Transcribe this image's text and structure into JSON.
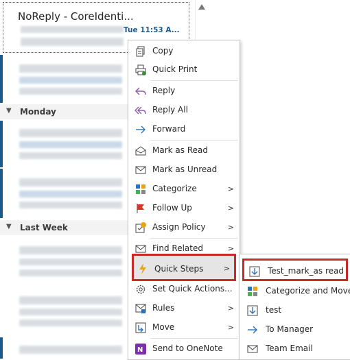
{
  "message_list": {
    "first_message": {
      "sender": "NoReply - CoreIdenti...",
      "time": "Tue 11:53 A..."
    },
    "groups": [
      {
        "label": "Monday"
      },
      {
        "label": "Last Week"
      }
    ]
  },
  "context_menu": {
    "items": [
      {
        "label": "Copy",
        "icon": "copy-icon"
      },
      {
        "label": "Quick Print",
        "icon": "print-icon"
      },
      {
        "label": "Reply",
        "icon": "reply-icon"
      },
      {
        "label": "Reply All",
        "icon": "reply-all-icon"
      },
      {
        "label": "Forward",
        "icon": "forward-icon"
      },
      {
        "label": "Mark as Read",
        "icon": "mark-read-icon"
      },
      {
        "label": "Mark as Unread",
        "icon": "mark-unread-icon"
      },
      {
        "label": "Categorize",
        "icon": "categorize-icon"
      },
      {
        "label": "Follow Up",
        "icon": "flag-icon"
      },
      {
        "label": "Assign Policy",
        "icon": "policy-icon"
      },
      {
        "label": "Find Related",
        "icon": "find-related-icon"
      },
      {
        "label": "Quick Steps",
        "icon": "quick-steps-icon"
      },
      {
        "label": "Set Quick Actions...",
        "icon": "gear-icon"
      },
      {
        "label": "Rules",
        "icon": "rules-icon"
      },
      {
        "label": "Move",
        "icon": "move-icon"
      },
      {
        "label": "Send to OneNote",
        "icon": "onenote-icon"
      }
    ]
  },
  "quick_steps_submenu": {
    "items": [
      {
        "label": "Test_mark_as read",
        "icon": "quick-step-icon"
      },
      {
        "label": "Categorize and Move",
        "icon": "categorize-icon"
      },
      {
        "label": "test",
        "icon": "quick-step-icon"
      },
      {
        "label": "To Manager",
        "icon": "forward-icon"
      },
      {
        "label": "Team Email",
        "icon": "mail-icon"
      }
    ]
  },
  "colors": {
    "accent_blue": "#1b5a8c",
    "highlight_red": "#c42b2b"
  }
}
